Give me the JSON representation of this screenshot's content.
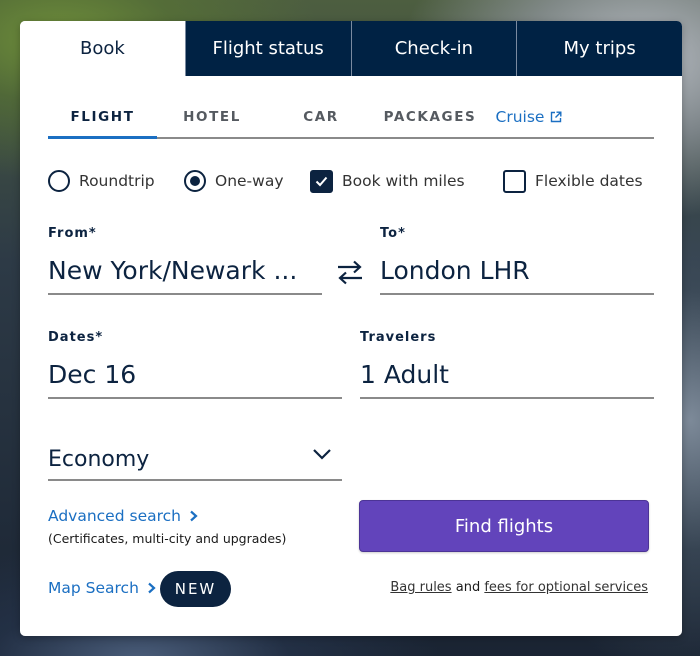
{
  "top_tabs": [
    {
      "label": "Book",
      "active": true
    },
    {
      "label": "Flight status",
      "active": false
    },
    {
      "label": "Check-in",
      "active": false
    },
    {
      "label": "My trips",
      "active": false
    }
  ],
  "sub_tabs": [
    {
      "label": "FLIGHT",
      "active": true
    },
    {
      "label": "HOTEL",
      "active": false
    },
    {
      "label": "CAR",
      "active": false
    },
    {
      "label": "PACKAGES",
      "active": false
    },
    {
      "label": "Cruise",
      "active": false,
      "icon": "external-link-icon"
    }
  ],
  "trip_options": {
    "roundtrip": {
      "label": "Roundtrip",
      "checked": false
    },
    "oneway": {
      "label": "One-way",
      "checked": true
    },
    "book_with_miles": {
      "label": "Book with miles",
      "checked": true
    },
    "flexible_dates": {
      "label": "Flexible dates",
      "checked": false
    }
  },
  "from": {
    "label": "From*",
    "value": "New York/Newark ..."
  },
  "swap_icon": "swap-arrows-icon",
  "to": {
    "label": "To*",
    "value": "London LHR"
  },
  "dates": {
    "label": "Dates*",
    "value": "Dec 16"
  },
  "travelers": {
    "label": "Travelers",
    "value": "1 Adult"
  },
  "cabin": {
    "selected": "Economy",
    "icon": "chevron-down-icon"
  },
  "advanced_search": {
    "label": "Advanced search",
    "subtext": "(Certificates, multi-city and upgrades)"
  },
  "map_search": {
    "label": "Map Search",
    "badge": "NEW"
  },
  "find_flights": {
    "label": "Find flights"
  },
  "fees": {
    "bag_rules": "Bag rules",
    "and": "and",
    "optional_fees": "fees for optional services"
  },
  "colors": {
    "navy": "#0c2340",
    "tab_bg": "#002244",
    "link_blue": "#1b6fc2",
    "button_purple": "#6244bb"
  }
}
